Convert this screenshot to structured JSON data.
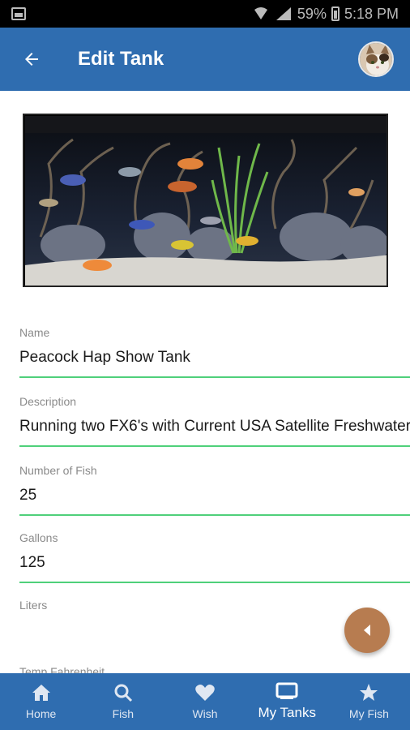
{
  "status_bar": {
    "battery_percent": "59%",
    "time": "5:18 PM"
  },
  "app_bar": {
    "title": "Edit Tank"
  },
  "tank_image": {
    "description_icon": "aquarium-photo"
  },
  "form": {
    "name": {
      "label": "Name",
      "value": "Peacock Hap Show Tank"
    },
    "description": {
      "label": "Description",
      "value": "Running two FX6's with Current USA Satellite Freshwater"
    },
    "num_fish": {
      "label": "Number of Fish",
      "value": "25"
    },
    "gallons": {
      "label": "Gallons",
      "value": "125"
    },
    "liters": {
      "label": "Liters",
      "value": ""
    },
    "temp_f": {
      "label": "Temp Fahrenheit",
      "value": ""
    }
  },
  "fab": {
    "icon": "caret-left-icon",
    "color": "#b77c50"
  },
  "bottom_nav": {
    "items": [
      {
        "label": "Home",
        "icon": "home-icon"
      },
      {
        "label": "Fish",
        "icon": "search-icon"
      },
      {
        "label": "Wish",
        "icon": "heart-icon"
      },
      {
        "label": "My Tanks",
        "icon": "tank-icon",
        "active": true
      },
      {
        "label": "My Fish",
        "icon": "star-icon"
      }
    ]
  },
  "colors": {
    "primary": "#2f6db0",
    "underline": "#4fd07a",
    "fab": "#b77c50"
  }
}
